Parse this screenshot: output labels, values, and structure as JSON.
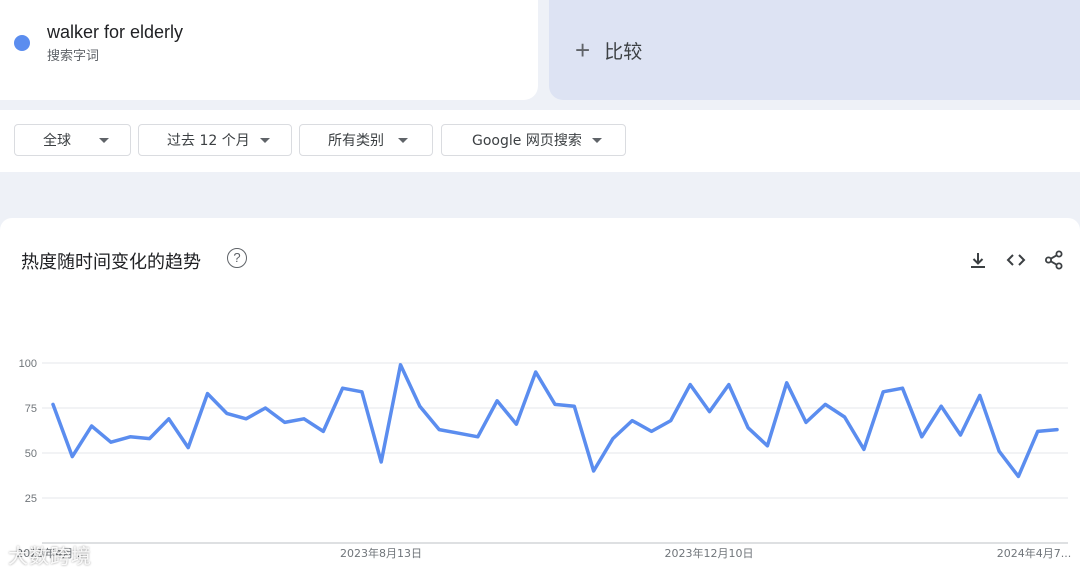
{
  "search_term": {
    "name": "walker for elderly",
    "subtitle": "搜索字词",
    "color": "#5b8def"
  },
  "compare": {
    "label": "比较",
    "icon": "plus-icon"
  },
  "filters": [
    {
      "label": "全球",
      "icon": "caret-down-icon"
    },
    {
      "label": "过去 12 个月",
      "icon": "caret-down-icon"
    },
    {
      "label": "所有类别",
      "icon": "caret-down-icon"
    },
    {
      "label": "Google 网页搜索",
      "icon": "caret-down-icon"
    }
  ],
  "chart_section": {
    "title": "热度随时间变化的趋势",
    "help_icon": "help-circle-icon",
    "tools": [
      "download-icon",
      "embed-code-icon",
      "share-icon"
    ]
  },
  "watermark": "大数跨境",
  "chart_data": {
    "type": "line",
    "ylim": [
      0,
      100
    ],
    "yticks": [
      25,
      50,
      75,
      100
    ],
    "x_tick_labels": [
      "2023年4月...",
      "2023年8月13日",
      "2023年12月10日",
      "2024年4月7..."
    ],
    "grid": true,
    "series": [
      {
        "color": "#5b8def",
        "values": [
          77,
          48,
          65,
          56,
          59,
          58,
          69,
          53,
          83,
          72,
          69,
          75,
          67,
          69,
          62,
          86,
          84,
          45,
          99,
          76,
          63,
          61,
          59,
          79,
          66,
          95,
          77,
          76,
          40,
          58,
          68,
          62,
          68,
          88,
          73,
          88,
          64,
          54,
          89,
          67,
          77,
          70,
          52,
          84,
          86,
          59,
          76,
          60,
          82,
          51,
          37,
          62,
          63
        ]
      }
    ]
  }
}
